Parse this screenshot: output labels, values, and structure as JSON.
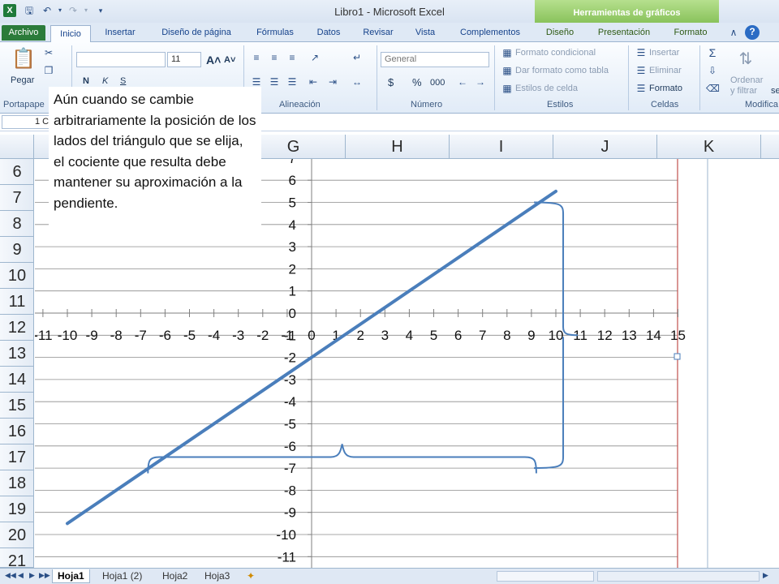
{
  "window": {
    "title": "Libro1  -  Microsoft Excel",
    "contextual_tab_group": "Herramientas de gráficos"
  },
  "tabs": [
    "Archivo",
    "Inicio",
    "Insertar",
    "Diseño de página",
    "Fórmulas",
    "Datos",
    "Revisar",
    "Vista",
    "Complementos",
    "Diseño",
    "Presentación",
    "Formato"
  ],
  "ribbon": {
    "paste_label": "Pegar",
    "clipboard_label": "Portapape",
    "font_size": "11",
    "alignment_label": "Alineación",
    "number_format": "General",
    "number_label": "Número",
    "conditional_format": "Formato condicional",
    "format_as_table": "Dar formato como tabla",
    "cell_styles": "Estilos de celda",
    "styles_label": "Estilos",
    "insert_cells": "Insertar",
    "delete_cells": "Eliminar",
    "format_cells": "Formato",
    "cells_label": "Celdas",
    "sort_filter_line1": "Ordenar",
    "sort_filter_line2": "y filtrar",
    "modify_label": "Modifica",
    "find_partial": "se",
    "currency": "$",
    "percent": "%",
    "thousands": "000",
    "bold": "N",
    "italic": "K",
    "underline": "S"
  },
  "namebox": "1 C",
  "columns": [
    "G",
    "H",
    "I",
    "J",
    "K"
  ],
  "rows": [
    "6",
    "7",
    "8",
    "9",
    "10",
    "11",
    "12",
    "13",
    "14",
    "15",
    "16",
    "17",
    "18",
    "19",
    "20",
    "21"
  ],
  "callout": {
    "text": "Aún cuando se cambie arbitrariamente  la posición de los lados del triángulo que se elija, el cociente que resulta debe mantener su aproximación a la pendiente."
  },
  "sheets": [
    "Hoja1",
    "Hoja1 (2)",
    "Hoja2",
    "Hoja3"
  ],
  "active_sheet": "Hoja1",
  "chart_data": {
    "type": "line",
    "title": "",
    "xlabel": "",
    "ylabel": "",
    "x_ticks": [
      "-11",
      "-10",
      "-9",
      "-8",
      "-7",
      "-6",
      "-5",
      "-4",
      "-3",
      "-2",
      "-1",
      "0",
      "1",
      "2",
      "3",
      "4",
      "5",
      "6",
      "7",
      "8",
      "9",
      "10",
      "11",
      "12",
      "13",
      "14",
      "15"
    ],
    "y_ticks": [
      "7",
      "6",
      "5",
      "4",
      "3",
      "2",
      "1",
      "0",
      "-1",
      "-2",
      "-3",
      "-4",
      "-5",
      "-6",
      "-7",
      "-8",
      "-9",
      "-10",
      "-11"
    ],
    "xlim": [
      -11,
      15
    ],
    "ylim": [
      -11,
      7
    ],
    "grid": true,
    "series": [
      {
        "x": [
          -10,
          10
        ],
        "y": [
          -9.5,
          5.5
        ],
        "color": "#4a7ebb"
      }
    ],
    "brackets": [
      {
        "orientation": "horizontal",
        "x_from": -6.7,
        "x_to": 9.2,
        "y": -6.5
      },
      {
        "orientation": "vertical",
        "x": 10.3,
        "y_from": 5.0,
        "y_to": -7.0
      }
    ]
  }
}
